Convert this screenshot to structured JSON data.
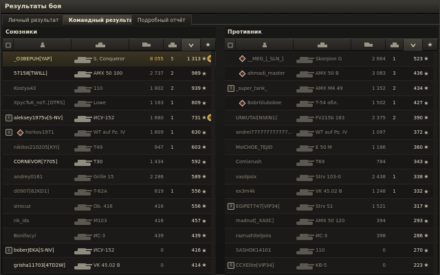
{
  "window": {
    "title": "Результаты боя"
  },
  "tabs": [
    {
      "label": "Личный результат",
      "active": false
    },
    {
      "label": "Командный результат",
      "active": true
    },
    {
      "label": "Подробный отчёт",
      "active": false
    }
  ],
  "allies": {
    "title": "Союзники",
    "rows": [
      {
        "platoon": "",
        "name": "_O3BEPUH[YAP]",
        "vehicle": "S. Conqueror",
        "damage": "8 055",
        "kills": "5",
        "xp": "1 313",
        "status": "alive",
        "medal": true,
        "highlight": true,
        "me": true
      },
      {
        "platoon": "",
        "name": "57158[TWILL]",
        "vehicle": "AMX 50 100",
        "damage": "2 737",
        "kills": "2",
        "xp": "989",
        "status": "alive",
        "medal": false
      },
      {
        "platoon": "",
        "name": "Kostya43",
        "vehicle": "110",
        "damage": "1 802",
        "kills": "2",
        "xp": "939",
        "status": "dead",
        "medal": false
      },
      {
        "platoon": "",
        "name": "XpycTuK_noT..[OTRS]",
        "vehicle": "Lowe",
        "damage": "1 163",
        "kills": "1",
        "xp": "809",
        "status": "dead",
        "medal": false
      },
      {
        "platoon": "I",
        "name": "aleksey1975v[S-NV]",
        "vehicle": "ИСУ-152",
        "damage": "1 880",
        "kills": "1",
        "xp": "731",
        "status": "alive",
        "medal": true
      },
      {
        "platoon": "I",
        "name": "horkov1971",
        "vehicle": "WT auf Pz. IV",
        "damage": "1 809",
        "kills": "1",
        "xp": "630",
        "status": "dead",
        "medal": false,
        "sub": true
      },
      {
        "platoon": "",
        "name": "nikitos210205[KYI]",
        "vehicle": "T49",
        "damage": "947",
        "kills": "1",
        "xp": "603",
        "status": "dead",
        "medal": false
      },
      {
        "platoon": "",
        "name": "CORNEVOR[7705]",
        "vehicle": "T30",
        "damage": "1 434",
        "kills": "",
        "xp": "592",
        "status": "alive",
        "medal": false
      },
      {
        "platoon": "",
        "name": "andrey0161",
        "vehicle": "Grille 15",
        "damage": "2 286",
        "kills": "",
        "xp": "589",
        "status": "dead",
        "medal": false
      },
      {
        "platoon": "",
        "name": "d0907[62KD1]",
        "vehicle": "T-62A",
        "damage": "819",
        "kills": "1",
        "xp": "556",
        "status": "dead",
        "medal": false
      },
      {
        "platoon": "",
        "name": "sirocuz",
        "vehicle": "Ob. 416",
        "damage": "416",
        "kills": "",
        "xp": "556",
        "status": "dead",
        "medal": false
      },
      {
        "platoon": "",
        "name": "rik_ids",
        "vehicle": "M103",
        "damage": "416",
        "kills": "",
        "xp": "457",
        "status": "dead",
        "medal": false
      },
      {
        "platoon": "",
        "name": "Bonifacyi",
        "vehicle": "ИС-3",
        "damage": "439",
        "kills": "",
        "xp": "439",
        "status": "dead",
        "medal": false
      },
      {
        "platoon": "I",
        "name": "boberJEKA[S-NV]",
        "vehicle": "ИСУ-152",
        "damage": "0",
        "kills": "",
        "xp": "416",
        "status": "alive",
        "medal": false
      },
      {
        "platoon": "",
        "name": "grisha11703[4TD2W]",
        "vehicle": "VK 45.02 B",
        "damage": "0",
        "kills": "",
        "xp": "414",
        "status": "alive",
        "medal": false
      }
    ]
  },
  "enemies": {
    "title": "Противник",
    "rows": [
      {
        "platoon": "",
        "name": "__MEG_[_SLN_]",
        "vehicle": "Skorpion G",
        "damage": "2 864",
        "kills": "1",
        "xp": "523",
        "status": "dead",
        "diamond": true
      },
      {
        "platoon": "",
        "name": "ahmadi_master",
        "vehicle": "AMX 50 B",
        "damage": "3 083",
        "kills": "3",
        "xp": "436",
        "status": "dead",
        "diamond": true
      },
      {
        "platoon": "I",
        "name": "_super_tank_",
        "vehicle": "AMX M4 49",
        "damage": "1 352",
        "kills": "2",
        "xp": "434",
        "status": "dead"
      },
      {
        "platoon": "",
        "name": "BobrGlubokoe",
        "vehicle": "T-54 обл.",
        "damage": "1 502",
        "kills": "1",
        "xp": "427",
        "status": "dead",
        "diamond": true
      },
      {
        "platoon": "",
        "name": "UNKUTAI[NSKN1]",
        "vehicle": "FV215b 183",
        "damage": "2 375",
        "kills": "2",
        "xp": "390",
        "status": "dead"
      },
      {
        "platoon": "",
        "name": "andrei777777777777...",
        "vehicle": "WT auf Pz. IV",
        "damage": "1 097",
        "kills": "",
        "xp": "372",
        "status": "dead"
      },
      {
        "platoon": "",
        "name": "MsICHOE_TEJID",
        "vehicle": "E 50 M",
        "damage": "1 186",
        "kills": "",
        "xp": "360",
        "status": "dead"
      },
      {
        "platoon": "",
        "name": "Comixrush",
        "vehicle": "T69",
        "damage": "784",
        "kills": "",
        "xp": "343",
        "status": "dead"
      },
      {
        "platoon": "",
        "name": "vasilpsix",
        "vehicle": "Strv 103-0",
        "damage": "2 438",
        "kills": "1",
        "xp": "338",
        "status": "dead"
      },
      {
        "platoon": "",
        "name": "ex3m4k",
        "vehicle": "VK 45.02 B",
        "damage": "1 248",
        "kills": "1",
        "xp": "332",
        "status": "dead"
      },
      {
        "platoon": "I",
        "name": "EGIPET747[VIP34]",
        "vehicle": "Strv S1",
        "damage": "1 521",
        "kills": "",
        "xp": "317",
        "status": "dead"
      },
      {
        "platoon": "",
        "name": "madnut[_XA0C]",
        "vehicle": "AMX 50 120",
        "damage": "394",
        "kills": "",
        "xp": "293",
        "status": "dead"
      },
      {
        "platoon": "",
        "name": "razrushiteljons",
        "vehicle": "ИС-3",
        "damage": "398",
        "kills": "",
        "xp": "286",
        "status": "dead"
      },
      {
        "platoon": "",
        "name": "SASHOK14101",
        "vehicle": "110",
        "damage": "0",
        "kills": "",
        "xp": "270",
        "status": "dead"
      },
      {
        "platoon": "I",
        "name": "CCXElite[VIP34]",
        "vehicle": "KB-5",
        "damage": "0",
        "kills": "",
        "xp": "223",
        "status": "dead"
      }
    ]
  },
  "icons": {
    "star": "★",
    "platoon_glyph": "I"
  },
  "colors": {
    "highlight": "#e5b35a",
    "text": "#c4bda8",
    "background": "#171716"
  }
}
